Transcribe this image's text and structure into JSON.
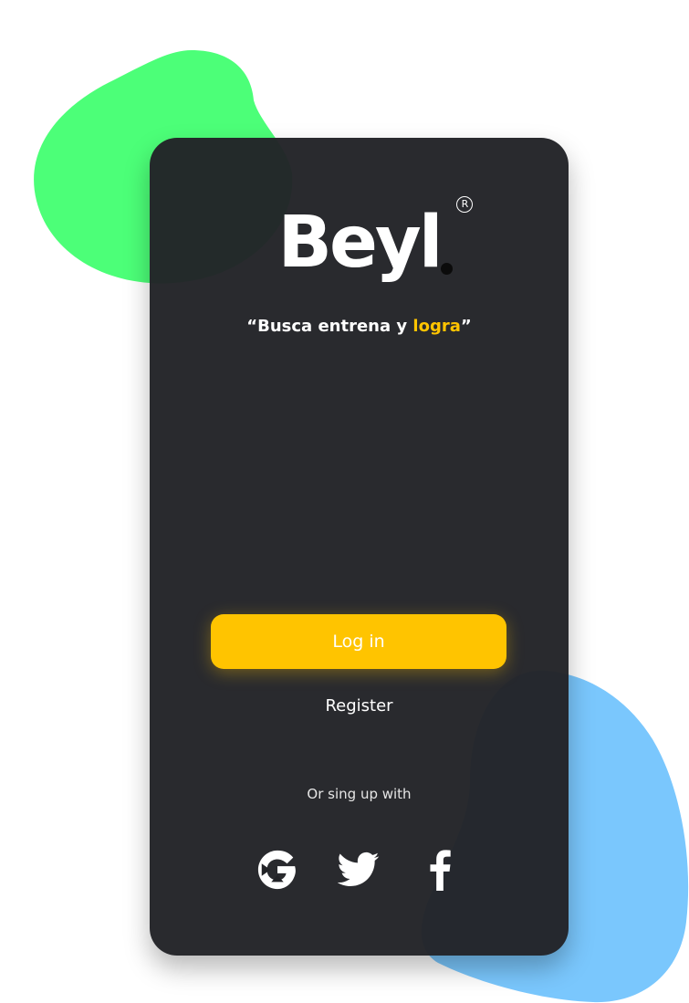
{
  "brand": {
    "name": "Beyl",
    "registered_mark": "R"
  },
  "tagline": {
    "open_quote": "“",
    "text": "Busca entrena y ",
    "accent": "logra",
    "close_quote": "”"
  },
  "actions": {
    "login_label": "Log in",
    "register_label": "Register"
  },
  "social": {
    "prompt": "Or sing up with",
    "providers": [
      {
        "name": "google",
        "icon": "google-icon"
      },
      {
        "name": "twitter",
        "icon": "twitter-icon"
      },
      {
        "name": "facebook",
        "icon": "facebook-icon"
      }
    ]
  },
  "colors": {
    "accent": "#ffc400",
    "card": "#222327",
    "blob_green": "#4cff78",
    "blob_blue": "#7ac7fd"
  }
}
